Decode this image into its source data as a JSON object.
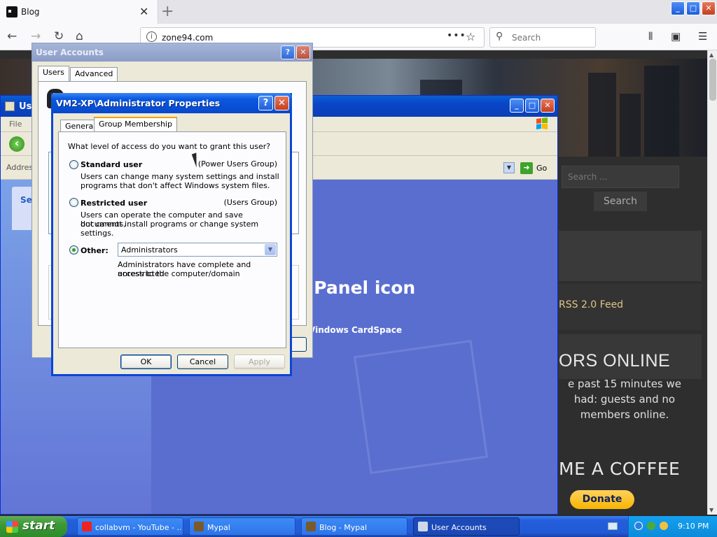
{
  "browser": {
    "tab_title": "Blog",
    "tab_close": "✕",
    "new_tab": "+",
    "url": "zone94.com",
    "page_actions": "•••",
    "search_placeholder": "Search"
  },
  "webpage": {
    "search_placeholder": "Search ...",
    "search_button": "Search",
    "rss_link": "RSS 2.0 Feed",
    "visitors_heading": "ORS ONLINE",
    "visitors_text": "e past 15 minutes we had: guests and no members online.",
    "coffee_heading": "ME A COFFEE",
    "donate_button": "Donate"
  },
  "control_panel": {
    "title": "Us",
    "menu_file": "File",
    "address_label": "Address",
    "go_label": "Go",
    "left_pane_heading": "Se",
    "main_heading": "l Panel icon",
    "main_sub": "Vindows CardSpace"
  },
  "user_accounts": {
    "title": "User Accounts",
    "tabs": [
      "Users",
      "Advanced"
    ]
  },
  "properties_dialog": {
    "title": "VM2-XP\\Administrator Properties",
    "tabs": [
      "General",
      "Group Membership"
    ],
    "question": "What level of access do you want to grant this user?",
    "options": [
      {
        "label": "Standard user",
        "group": "(Power Users Group)",
        "description_1": "Users can change many system settings and install",
        "description_2": "programs that don't affect Windows system files."
      },
      {
        "label": "Restricted user",
        "group": "(Users Group)",
        "description_1": "Users can operate the computer and save documents,",
        "description_2": "but cannot install programs or change system settings."
      },
      {
        "label": "Other:",
        "selected_value": "Administrators",
        "description_1": "Administrators have complete and unrestricted",
        "description_2": "access to the computer/domain"
      }
    ],
    "selected_option": "Other:",
    "buttons": {
      "ok": "OK",
      "cancel": "Cancel",
      "apply": "Apply"
    }
  },
  "title_buttons": {
    "help": "?",
    "close": "✕",
    "minimize": "_",
    "maximize": "□"
  },
  "taskbar": {
    "start_label": "start",
    "items": [
      {
        "label": "collabvm - YouTube - ...",
        "icon": "youtube-icon",
        "color": "#e22"
      },
      {
        "label": "Mypal",
        "icon": "mypal-icon",
        "color": "#7a5a2a"
      },
      {
        "label": "Blog - Mypal",
        "icon": "mypal-icon",
        "color": "#7a5a2a"
      },
      {
        "label": "User Accounts",
        "icon": "user-accounts-icon",
        "color": "#cfd8e8"
      }
    ],
    "clock": "9:10 PM"
  }
}
